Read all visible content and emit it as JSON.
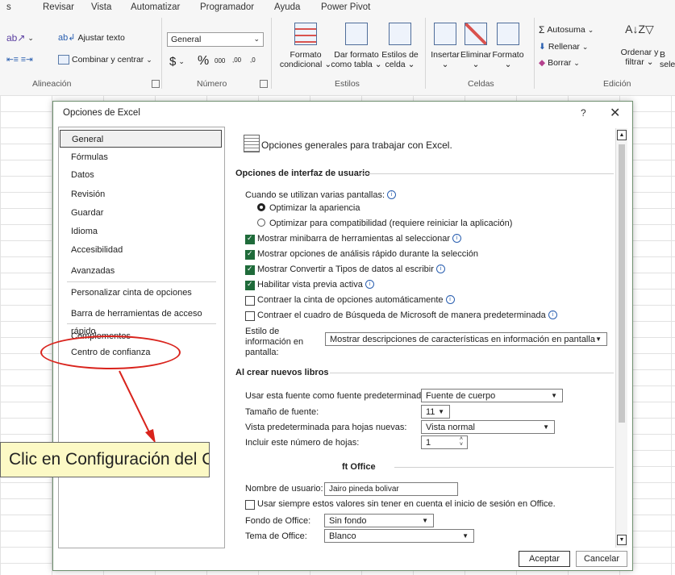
{
  "ribbon": {
    "tabs": [
      "s",
      "Revisar",
      "Vista",
      "Automatizar",
      "Programador",
      "Ayuda",
      "Power Pivot"
    ],
    "alignment": {
      "wrap_text": "Ajustar texto",
      "merge_center": "Combinar y centrar",
      "group": "Alineación"
    },
    "number": {
      "format": "General",
      "currency": "$",
      "percent": "%",
      "thousands": "000",
      "inc_dec": ",00",
      "dec_dec": ",0",
      "group": "Número"
    },
    "styles": {
      "cond_format_l1": "Formato",
      "cond_format_l2": "condicional",
      "table_format_l1": "Dar formato",
      "table_format_l2": "como tabla",
      "cell_styles_l1": "Estilos de",
      "cell_styles_l2": "celda",
      "group": "Estilos"
    },
    "cells": {
      "insert": "Insertar",
      "delete": "Eliminar",
      "format": "Formato",
      "group": "Celdas"
    },
    "editing": {
      "autosum": "Autosuma",
      "fill": "Rellenar",
      "clear": "Borrar",
      "sort_l1": "Ordenar y",
      "sort_l2": "filtrar",
      "find_l1": "B",
      "find_l2": "selec",
      "group": "Edición"
    }
  },
  "dialog": {
    "title": "Opciones de Excel",
    "help": "?",
    "close": "✕",
    "nav": [
      {
        "label": "General"
      },
      {
        "label": "Fórmulas"
      },
      {
        "label": "Datos"
      },
      {
        "label": "Revisión"
      },
      {
        "label": "Guardar"
      },
      {
        "label": "Idioma"
      },
      {
        "label": "Accesibilidad"
      },
      {
        "label": "Avanzadas"
      },
      {
        "label": "Personalizar cinta de opciones"
      },
      {
        "label": "Barra de herramientas de acceso rápido"
      },
      {
        "label": "Complementos"
      },
      {
        "label": "Centro de confianza"
      }
    ],
    "header": "Opciones generales para trabajar con Excel.",
    "ui_section": "Opciones de interfaz de usuario",
    "multi_screen": "Cuando se utilizan varias pantallas:",
    "radio_optimize": "Optimizar la apariencia",
    "radio_compat": "Optimizar para compatibilidad (requiere reiniciar la aplicación)",
    "chk_minibar": "Mostrar minibarra de herramientas al seleccionar",
    "chk_quick": "Mostrar opciones de análisis rápido durante la selección",
    "chk_convert": "Mostrar Convertir a Tipos de datos al escribir",
    "chk_preview": "Habilitar vista previa activa",
    "chk_collapse": "Contraer la cinta de opciones automáticamente",
    "chk_search": "Contraer el cuadro de Búsqueda de Microsoft de manera predeterminada",
    "tooltip_l1": "Estilo de",
    "tooltip_l2": "información en",
    "tooltip_l3": "pantalla:",
    "tooltip_value": "Mostrar descripciones de características en información en pantalla",
    "new_books_section": "Al crear nuevos libros",
    "font_label": "Usar esta fuente como fuente predeterminada:",
    "font_value": "Fuente de cuerpo",
    "size_label": "Tamaño de fuente:",
    "size_value": "11",
    "view_label": "Vista predeterminada para hojas nuevas:",
    "view_value": "Vista normal",
    "sheets_label": "Incluir este número de hojas:",
    "sheets_value": "1",
    "office_section": "ft Office",
    "user_label": "Nombre de usuario:",
    "user_value": "Jairo pineda bolivar",
    "chk_always": "Usar siempre estos valores sin tener en cuenta el inicio de sesión en Office.",
    "bg_label": "Fondo de Office:",
    "bg_value": "Sin fondo",
    "theme_label": "Tema de Office:",
    "theme_value": "Blanco",
    "ok": "Aceptar",
    "cancel": "Cancelar"
  },
  "callout": "Clic en Configuración del Centro",
  "colors": {
    "accent_check": "#1f6b3a",
    "callout_bg": "#fcf9c5",
    "annotation_red": "#d9231c"
  }
}
